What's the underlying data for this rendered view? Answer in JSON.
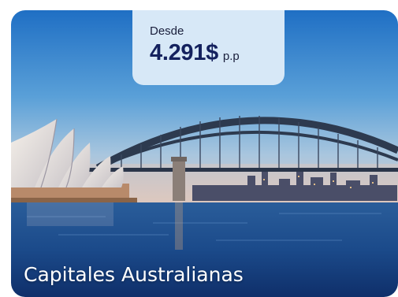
{
  "card": {
    "price_prefix": "Desde",
    "price_amount": "4.291$",
    "price_unit": "p.p",
    "title": "Capitales Australianas"
  },
  "colors": {
    "badge_background": "#d7e8f7",
    "price_text": "#14215e",
    "title_text": "#ffffff"
  }
}
